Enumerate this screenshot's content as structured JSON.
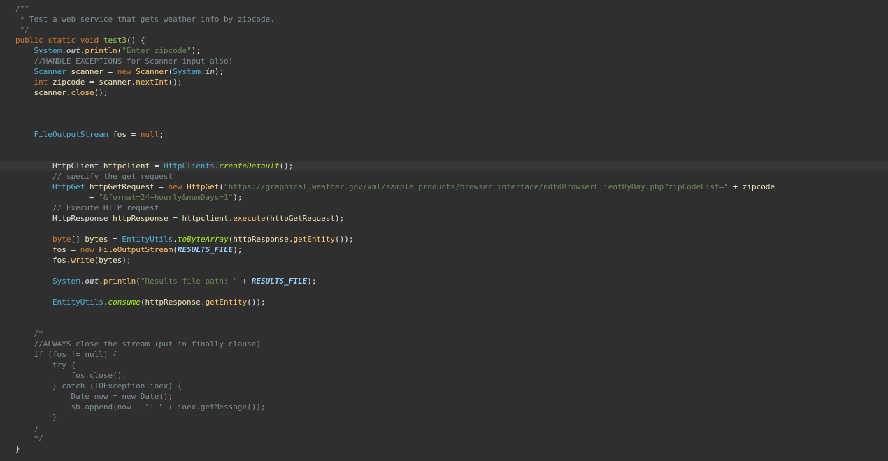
{
  "editor": {
    "lines": [
      {
        "tokens": [
          {
            "t": "/**",
            "c": "tok-javadoc"
          }
        ]
      },
      {
        "tokens": [
          {
            "t": " * Test a web service that gets weather info by zipcode.",
            "c": "tok-javadoc"
          }
        ]
      },
      {
        "tokens": [
          {
            "t": " */",
            "c": "tok-javadoc"
          }
        ]
      },
      {
        "tokens": [
          {
            "t": "public",
            "c": "tok-keyword"
          },
          {
            "t": " ",
            "c": "tok-plain"
          },
          {
            "t": "static",
            "c": "tok-keyword"
          },
          {
            "t": " ",
            "c": "tok-plain"
          },
          {
            "t": "void",
            "c": "tok-keyword"
          },
          {
            "t": " ",
            "c": "tok-plain"
          },
          {
            "t": "test3",
            "c": "tok-decl"
          },
          {
            "t": "() {",
            "c": "tok-punct"
          }
        ]
      },
      {
        "tokens": [
          {
            "t": "    ",
            "c": "tok-plain"
          },
          {
            "t": "System",
            "c": "tok-type2"
          },
          {
            "t": ".",
            "c": "tok-punct"
          },
          {
            "t": "out",
            "c": "tok-static"
          },
          {
            "t": ".",
            "c": "tok-punct"
          },
          {
            "t": "println",
            "c": "tok-method"
          },
          {
            "t": "(",
            "c": "tok-punct"
          },
          {
            "t": "\"Enter zipcode\"",
            "c": "tok-string"
          },
          {
            "t": ");",
            "c": "tok-punct"
          }
        ]
      },
      {
        "tokens": [
          {
            "t": "    //HANDLE EXCEPTIONS for Scanner input also!",
            "c": "tok-comment"
          }
        ]
      },
      {
        "tokens": [
          {
            "t": "    ",
            "c": "tok-plain"
          },
          {
            "t": "Scanner",
            "c": "tok-type2"
          },
          {
            "t": " ",
            "c": "tok-plain"
          },
          {
            "t": "scanner",
            "c": "tok-var"
          },
          {
            "t": " = ",
            "c": "tok-punct"
          },
          {
            "t": "new",
            "c": "tok-keyword"
          },
          {
            "t": " ",
            "c": "tok-plain"
          },
          {
            "t": "Scanner",
            "c": "tok-method"
          },
          {
            "t": "(",
            "c": "tok-punct"
          },
          {
            "t": "System",
            "c": "tok-type2"
          },
          {
            "t": ".",
            "c": "tok-punct"
          },
          {
            "t": "in",
            "c": "tok-static"
          },
          {
            "t": ");",
            "c": "tok-punct"
          }
        ]
      },
      {
        "tokens": [
          {
            "t": "    ",
            "c": "tok-plain"
          },
          {
            "t": "int",
            "c": "tok-keyword"
          },
          {
            "t": " ",
            "c": "tok-plain"
          },
          {
            "t": "zipcode",
            "c": "tok-var"
          },
          {
            "t": " = ",
            "c": "tok-punct"
          },
          {
            "t": "scanner",
            "c": "tok-var"
          },
          {
            "t": ".",
            "c": "tok-punct"
          },
          {
            "t": "nextInt",
            "c": "tok-method"
          },
          {
            "t": "();",
            "c": "tok-punct"
          }
        ]
      },
      {
        "tokens": [
          {
            "t": "    ",
            "c": "tok-plain"
          },
          {
            "t": "scanner",
            "c": "tok-var"
          },
          {
            "t": ".",
            "c": "tok-punct"
          },
          {
            "t": "close",
            "c": "tok-method"
          },
          {
            "t": "();",
            "c": "tok-punct"
          }
        ]
      },
      {
        "tokens": []
      },
      {
        "tokens": []
      },
      {
        "tokens": []
      },
      {
        "tokens": [
          {
            "t": "    ",
            "c": "tok-plain"
          },
          {
            "t": "FileOutputStream",
            "c": "tok-type2"
          },
          {
            "t": " ",
            "c": "tok-plain"
          },
          {
            "t": "fos",
            "c": "tok-var"
          },
          {
            "t": " = ",
            "c": "tok-punct"
          },
          {
            "t": "null",
            "c": "tok-keyword"
          },
          {
            "t": ";",
            "c": "tok-punct"
          }
        ]
      },
      {
        "tokens": []
      },
      {
        "tokens": []
      },
      {
        "current": true,
        "tokens": [
          {
            "t": "        ",
            "c": "tok-plain"
          },
          {
            "t": "HttpClient",
            "c": "tok-field"
          },
          {
            "t": " ",
            "c": "tok-plain"
          },
          {
            "t": "httpclient",
            "c": "tok-var"
          },
          {
            "t": " = ",
            "c": "tok-punct"
          },
          {
            "t": "HttpClients",
            "c": "tok-type2"
          },
          {
            "t": ".",
            "c": "tok-punct"
          },
          {
            "t": "createDefault",
            "c": "tok-italic-method"
          },
          {
            "t": "();",
            "c": "tok-punct"
          }
        ]
      },
      {
        "tokens": [
          {
            "t": "        // specify the get request",
            "c": "tok-comment"
          }
        ]
      },
      {
        "tokens": [
          {
            "t": "        ",
            "c": "tok-plain"
          },
          {
            "t": "HttpGet",
            "c": "tok-type2"
          },
          {
            "t": " ",
            "c": "tok-plain"
          },
          {
            "t": "httpGetRequest",
            "c": "tok-var"
          },
          {
            "t": " = ",
            "c": "tok-punct"
          },
          {
            "t": "new",
            "c": "tok-keyword"
          },
          {
            "t": " ",
            "c": "tok-plain"
          },
          {
            "t": "HttpGet",
            "c": "tok-method"
          },
          {
            "t": "(",
            "c": "tok-punct"
          },
          {
            "t": "\"https://graphical.weather.gov/xml/sample_products/browser_interface/ndfdBrowserClientByDay.php?zipCodeList=\"",
            "c": "tok-string"
          },
          {
            "t": " + ",
            "c": "tok-punct"
          },
          {
            "t": "zipcode",
            "c": "tok-var"
          }
        ]
      },
      {
        "tokens": [
          {
            "t": "                ",
            "c": "tok-plain"
          },
          {
            "t": "+ ",
            "c": "tok-punct"
          },
          {
            "t": "\"&format=24+hourly&numDays=1\"",
            "c": "tok-string"
          },
          {
            "t": ");",
            "c": "tok-punct"
          }
        ]
      },
      {
        "tokens": [
          {
            "t": "        // Execute HTTP request",
            "c": "tok-comment"
          }
        ]
      },
      {
        "tokens": [
          {
            "t": "        ",
            "c": "tok-plain"
          },
          {
            "t": "HttpResponse",
            "c": "tok-field"
          },
          {
            "t": " ",
            "c": "tok-plain"
          },
          {
            "t": "httpResponse",
            "c": "tok-var"
          },
          {
            "t": " = ",
            "c": "tok-punct"
          },
          {
            "t": "httpclient",
            "c": "tok-var"
          },
          {
            "t": ".",
            "c": "tok-punct"
          },
          {
            "t": "execute",
            "c": "tok-method"
          },
          {
            "t": "(",
            "c": "tok-punct"
          },
          {
            "t": "httpGetRequest",
            "c": "tok-var"
          },
          {
            "t": ");",
            "c": "tok-punct"
          }
        ]
      },
      {
        "tokens": []
      },
      {
        "tokens": [
          {
            "t": "        ",
            "c": "tok-plain"
          },
          {
            "t": "byte",
            "c": "tok-keyword"
          },
          {
            "t": "[] ",
            "c": "tok-punct"
          },
          {
            "t": "bytes",
            "c": "tok-var"
          },
          {
            "t": " = ",
            "c": "tok-punct"
          },
          {
            "t": "EntityUtils",
            "c": "tok-type2"
          },
          {
            "t": ".",
            "c": "tok-punct"
          },
          {
            "t": "toByteArray",
            "c": "tok-italic-method"
          },
          {
            "t": "(",
            "c": "tok-punct"
          },
          {
            "t": "httpResponse",
            "c": "tok-var"
          },
          {
            "t": ".",
            "c": "tok-punct"
          },
          {
            "t": "getEntity",
            "c": "tok-method"
          },
          {
            "t": "());",
            "c": "tok-punct"
          }
        ]
      },
      {
        "tokens": [
          {
            "t": "        ",
            "c": "tok-plain"
          },
          {
            "t": "fos",
            "c": "tok-var"
          },
          {
            "t": " = ",
            "c": "tok-punct"
          },
          {
            "t": "new",
            "c": "tok-keyword"
          },
          {
            "t": " ",
            "c": "tok-plain"
          },
          {
            "t": "FileOutputStream",
            "c": "tok-method"
          },
          {
            "t": "(",
            "c": "tok-punct"
          },
          {
            "t": "RESULTS_FILE",
            "c": "tok-const"
          },
          {
            "t": ");",
            "c": "tok-punct"
          }
        ]
      },
      {
        "tokens": [
          {
            "t": "        ",
            "c": "tok-plain"
          },
          {
            "t": "fos",
            "c": "tok-var"
          },
          {
            "t": ".",
            "c": "tok-punct"
          },
          {
            "t": "write",
            "c": "tok-method"
          },
          {
            "t": "(",
            "c": "tok-punct"
          },
          {
            "t": "bytes",
            "c": "tok-var"
          },
          {
            "t": ");",
            "c": "tok-punct"
          }
        ]
      },
      {
        "tokens": []
      },
      {
        "tokens": [
          {
            "t": "        ",
            "c": "tok-plain"
          },
          {
            "t": "System",
            "c": "tok-type2"
          },
          {
            "t": ".",
            "c": "tok-punct"
          },
          {
            "t": "out",
            "c": "tok-static"
          },
          {
            "t": ".",
            "c": "tok-punct"
          },
          {
            "t": "println",
            "c": "tok-method"
          },
          {
            "t": "(",
            "c": "tok-punct"
          },
          {
            "t": "\"Results file path: \"",
            "c": "tok-string"
          },
          {
            "t": " + ",
            "c": "tok-punct"
          },
          {
            "t": "RESULTS_FILE",
            "c": "tok-const"
          },
          {
            "t": ");",
            "c": "tok-punct"
          }
        ]
      },
      {
        "tokens": []
      },
      {
        "tokens": [
          {
            "t": "        ",
            "c": "tok-plain"
          },
          {
            "t": "EntityUtils",
            "c": "tok-type2"
          },
          {
            "t": ".",
            "c": "tok-punct"
          },
          {
            "t": "consume",
            "c": "tok-italic-method"
          },
          {
            "t": "(",
            "c": "tok-punct"
          },
          {
            "t": "httpResponse",
            "c": "tok-var"
          },
          {
            "t": ".",
            "c": "tok-punct"
          },
          {
            "t": "getEntity",
            "c": "tok-method"
          },
          {
            "t": "());",
            "c": "tok-punct"
          }
        ]
      },
      {
        "tokens": []
      },
      {
        "tokens": []
      },
      {
        "tokens": [
          {
            "t": "    /*",
            "c": "tok-comment"
          }
        ]
      },
      {
        "tokens": [
          {
            "t": "    //ALWAYS close the stream (put in finally clause)",
            "c": "tok-comment"
          }
        ]
      },
      {
        "tokens": [
          {
            "t": "    if (fos != null) {",
            "c": "tok-comment"
          }
        ]
      },
      {
        "tokens": [
          {
            "t": "        try {",
            "c": "tok-comment"
          }
        ]
      },
      {
        "tokens": [
          {
            "t": "            fos.close();",
            "c": "tok-comment"
          }
        ]
      },
      {
        "tokens": [
          {
            "t": "        } catch (IOException ioex) {",
            "c": "tok-comment"
          }
        ]
      },
      {
        "tokens": [
          {
            "t": "            Date now = new Date();",
            "c": "tok-comment"
          }
        ]
      },
      {
        "tokens": [
          {
            "t": "            sb.append(now + \": \" + ioex.getMessage());",
            "c": "tok-comment"
          }
        ]
      },
      {
        "tokens": [
          {
            "t": "        }",
            "c": "tok-comment"
          }
        ]
      },
      {
        "tokens": [
          {
            "t": "    }",
            "c": "tok-comment"
          }
        ]
      },
      {
        "tokens": [
          {
            "t": "    */",
            "c": "tok-comment"
          }
        ]
      },
      {
        "tokens": [
          {
            "t": "}",
            "c": "tok-punct"
          }
        ]
      }
    ]
  }
}
